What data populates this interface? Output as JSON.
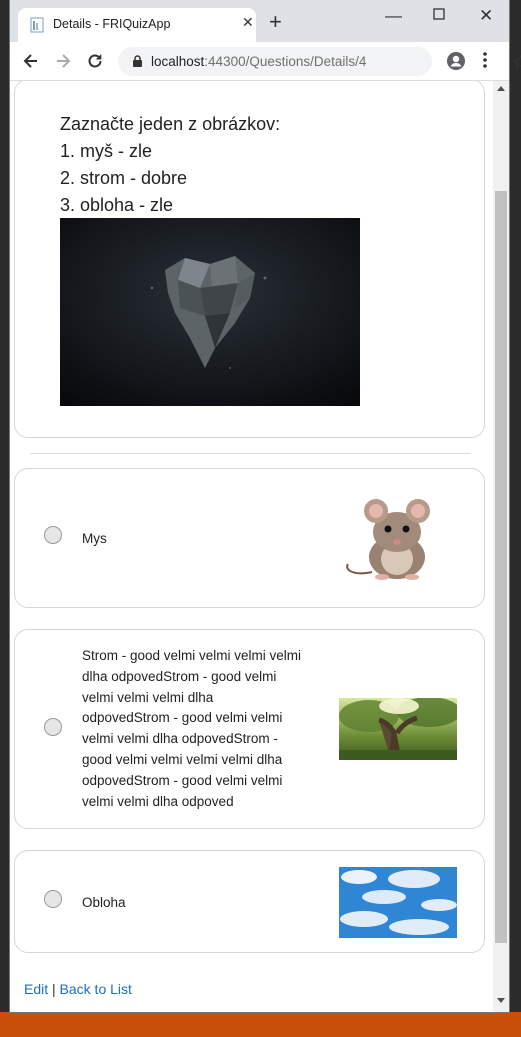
{
  "browser": {
    "tab_title": "Details - FRIQuizApp",
    "url_host": "localhost",
    "url_path": ":44300/Questions/Details/4"
  },
  "question": {
    "prompt": "Zaznačte jeden z obrázkov:",
    "lines": [
      "1. myš - zle",
      "2. strom - dobre",
      "3. obloha - zle"
    ],
    "image": "dark-crystal-heart-image"
  },
  "answers": [
    {
      "text": "Mys",
      "image": "mouse-image"
    },
    {
      "text": "Strom - good velmi velmi velmi velmi dlha odpovedStrom - good velmi velmi velmi velmi dlha odpovedStrom - good velmi velmi velmi velmi dlha odpovedStrom - good velmi velmi velmi velmi dlha odpovedStrom - good velmi velmi velmi velmi dlha odpoved",
      "image": "tree-image"
    },
    {
      "text": "Obloha",
      "image": "sky-image"
    }
  ],
  "footer": {
    "edit_label": "Edit",
    "separator": "|",
    "back_label": "Back to List"
  },
  "colors": {
    "link": "#1a6fc0",
    "taskbar": "#c8500a",
    "chrome_frame": "#dee1e6"
  }
}
